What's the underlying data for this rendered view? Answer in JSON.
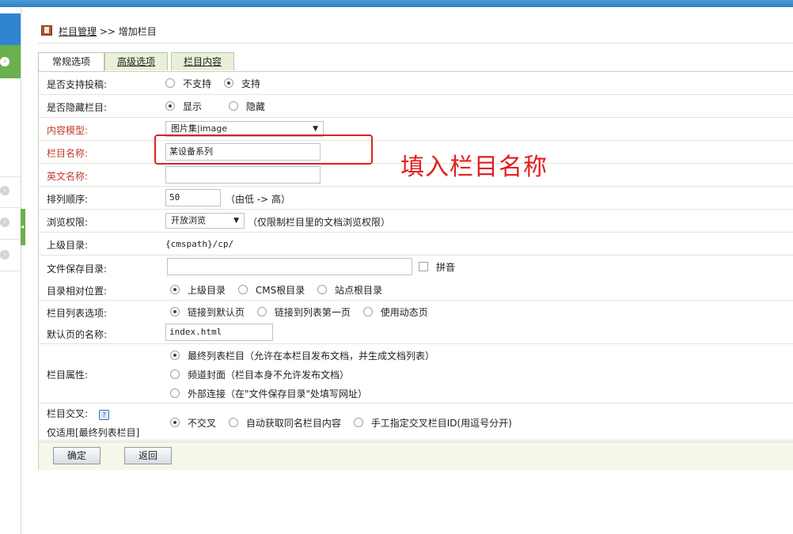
{
  "breadcrumb": {
    "root": "栏目管理",
    "sep": ">>",
    "current": "增加栏目"
  },
  "tabs": [
    {
      "label": "常规选项"
    },
    {
      "label": "高级选项"
    },
    {
      "label": "栏目内容"
    }
  ],
  "form": {
    "submission": {
      "label": "是否支持投稿:",
      "opt1": "不支持",
      "opt2": "支持",
      "selected": "支持"
    },
    "hidden": {
      "label": "是否隐藏栏目:",
      "opt1": "显示",
      "opt2": "隐藏",
      "selected": "显示"
    },
    "model": {
      "label": "内容模型:",
      "value": "图片集|image"
    },
    "name": {
      "label": "栏目名称:",
      "value": "某设备系列"
    },
    "en_name": {
      "label": "英文名称:",
      "value": ""
    },
    "order": {
      "label": "排列顺序:",
      "value": "50",
      "hint": "（由低 -> 高）"
    },
    "perm": {
      "label": "浏览权限:",
      "value": "开放浏览",
      "hint": "（仅限制栏目里的文档浏览权限）"
    },
    "parent": {
      "label": "上级目录:",
      "value": "{cmspath}/cp/"
    },
    "save_dir": {
      "label": "文件保存目录:",
      "value": "",
      "pinyin": "拼音"
    },
    "rel_pos": {
      "label": "目录相对位置:",
      "opt1": "上级目录",
      "opt2": "CMS根目录",
      "opt3": "站点根目录",
      "selected": "上级目录"
    },
    "list_opt": {
      "label": "栏目列表选项:",
      "opt1": "链接到默认页",
      "opt2": "链接到列表第一页",
      "opt3": "使用动态页",
      "selected": "链接到默认页"
    },
    "default_page": {
      "label": "默认页的名称:",
      "value": "index.html"
    },
    "attr": {
      "label": "栏目属性:",
      "opt1": "最终列表栏目（允许在本栏目发布文档，并生成文档列表）",
      "opt2": "频道封面（栏目本身不允许发布文档）",
      "opt3": "外部连接（在\"文件保存目录\"处填写网址）",
      "selected": "最终列表栏目（允许在本栏目发布文档，并生成文档列表）"
    },
    "cross": {
      "label": "栏目交叉:",
      "label2": "仅适用[最终列表栏目]",
      "opt1": "不交叉",
      "opt2": "自动获取同名栏目内容",
      "opt3": "手工指定交叉栏目ID(用逗号分开)",
      "selected": "不交叉"
    }
  },
  "buttons": {
    "confirm": "确定",
    "back": "返回"
  },
  "annotation": {
    "text": "填入栏目名称",
    "color": "#e31e1e"
  }
}
